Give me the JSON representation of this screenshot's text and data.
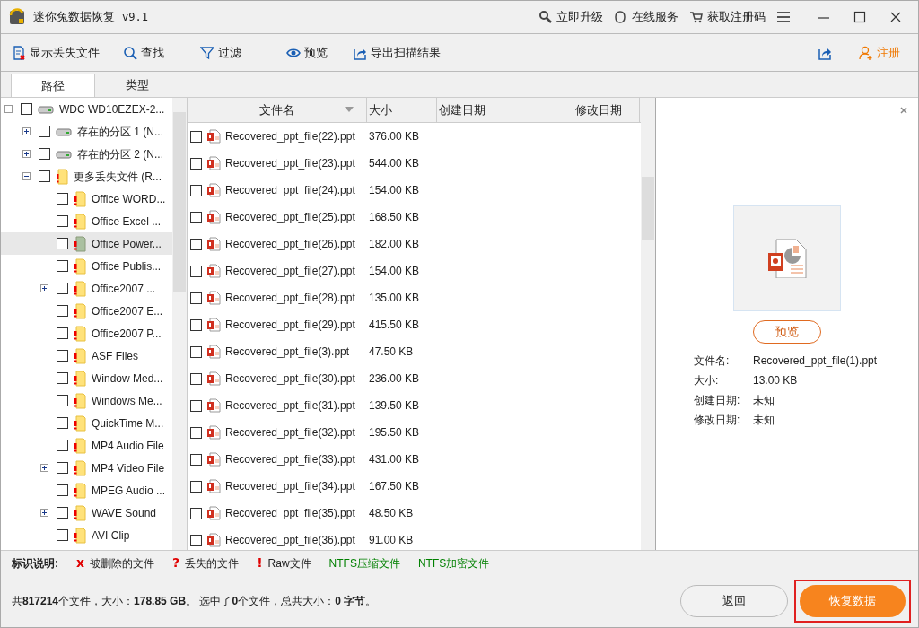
{
  "window": {
    "title": "迷你兔数据恢复",
    "version": "v9.1",
    "links": [
      {
        "kind": "key",
        "label": "立即升级"
      },
      {
        "kind": "chat",
        "label": "在线服务"
      },
      {
        "kind": "cart",
        "label": "获取注册码"
      }
    ]
  },
  "toolbar": [
    {
      "kind": "lost",
      "label": "显示丢失文件"
    },
    {
      "kind": "search",
      "label": "查找"
    },
    {
      "kind": "filter",
      "label": "过滤"
    },
    {
      "kind": "eye",
      "label": "预览"
    },
    {
      "kind": "export",
      "label": "导出扫描结果"
    }
  ],
  "register": "注册",
  "tabs": [
    {
      "label": "路径",
      "selected": true
    },
    {
      "label": "类型",
      "selected": false
    }
  ],
  "tree": [
    {
      "kind": "drive",
      "label": "WDC WD10EZEX-2...",
      "checked": false,
      "selected": false,
      "expanded": true,
      "children": [
        {
          "kind": "drive",
          "label": "存在的分区 1 (N...",
          "checked": false,
          "selected": false,
          "expanded": false
        },
        {
          "kind": "drive",
          "label": "存在的分区 2 (N...",
          "checked": false,
          "selected": false,
          "expanded": false
        },
        {
          "kind": "folder",
          "label": "更多丢失文件 (R...",
          "checked": false,
          "selected": false,
          "expanded": true,
          "children": [
            {
              "kind": "folder",
              "label": "Office WORD...",
              "checked": false,
              "selected": false
            },
            {
              "kind": "folder",
              "label": "Office Excel ...",
              "checked": false,
              "selected": false
            },
            {
              "kind": "folder",
              "label": "Office Power...",
              "checked": false,
              "selected": true
            },
            {
              "kind": "folder",
              "label": "Office Publis...",
              "checked": false,
              "selected": false
            },
            {
              "kind": "folder",
              "label": "Office2007 ...",
              "checked": false,
              "selected": false,
              "expanded": false
            },
            {
              "kind": "folder",
              "label": "Office2007 E...",
              "checked": false,
              "selected": false
            },
            {
              "kind": "folder",
              "label": "Office2007 P...",
              "checked": false,
              "selected": false
            },
            {
              "kind": "folder",
              "label": "ASF Files",
              "checked": false,
              "selected": false
            },
            {
              "kind": "folder",
              "label": "Window Med...",
              "checked": false,
              "selected": false
            },
            {
              "kind": "folder",
              "label": "Windows Me...",
              "checked": false,
              "selected": false
            },
            {
              "kind": "folder",
              "label": "QuickTime M...",
              "checked": false,
              "selected": false
            },
            {
              "kind": "folder",
              "label": "MP4 Audio File",
              "checked": false,
              "selected": false
            },
            {
              "kind": "folder",
              "label": "MP4 Video File",
              "checked": false,
              "selected": false,
              "expanded": false
            },
            {
              "kind": "folder",
              "label": "MPEG Audio ...",
              "checked": false,
              "selected": false
            },
            {
              "kind": "folder",
              "label": "WAVE Sound",
              "checked": false,
              "selected": false,
              "expanded": false
            },
            {
              "kind": "folder",
              "label": "AVI Clip",
              "checked": false,
              "selected": false
            }
          ]
        }
      ]
    }
  ],
  "table": {
    "columns": [
      "文件名",
      "大小",
      "创建日期",
      "修改日期"
    ],
    "rows": [
      {
        "name": "Recovered_ppt_file(22).ppt",
        "size": "376.00 KB",
        "checked": false
      },
      {
        "name": "Recovered_ppt_file(23).ppt",
        "size": "544.00 KB",
        "checked": false
      },
      {
        "name": "Recovered_ppt_file(24).ppt",
        "size": "154.00 KB",
        "checked": false
      },
      {
        "name": "Recovered_ppt_file(25).ppt",
        "size": "168.50 KB",
        "checked": false
      },
      {
        "name": "Recovered_ppt_file(26).ppt",
        "size": "182.00 KB",
        "checked": false
      },
      {
        "name": "Recovered_ppt_file(27).ppt",
        "size": "154.00 KB",
        "checked": false
      },
      {
        "name": "Recovered_ppt_file(28).ppt",
        "size": "135.00 KB",
        "checked": false
      },
      {
        "name": "Recovered_ppt_file(29).ppt",
        "size": "415.50 KB",
        "checked": false
      },
      {
        "name": "Recovered_ppt_file(3).ppt",
        "size": "47.50 KB",
        "checked": false
      },
      {
        "name": "Recovered_ppt_file(30).ppt",
        "size": "236.00 KB",
        "checked": false
      },
      {
        "name": "Recovered_ppt_file(31).ppt",
        "size": "139.50 KB",
        "checked": false
      },
      {
        "name": "Recovered_ppt_file(32).ppt",
        "size": "195.50 KB",
        "checked": false
      },
      {
        "name": "Recovered_ppt_file(33).ppt",
        "size": "431.00 KB",
        "checked": false
      },
      {
        "name": "Recovered_ppt_file(34).ppt",
        "size": "167.50 KB",
        "checked": false
      },
      {
        "name": "Recovered_ppt_file(35).ppt",
        "size": "48.50 KB",
        "checked": false
      },
      {
        "name": "Recovered_ppt_file(36).ppt",
        "size": "91.00 KB",
        "checked": false
      }
    ]
  },
  "preview": {
    "button": "预览",
    "fields": [
      {
        "label": "文件名:",
        "value": "Recovered_ppt_file(1).ppt"
      },
      {
        "label": "大小:",
        "value": "13.00 KB"
      },
      {
        "label": "创建日期:",
        "value": "未知"
      },
      {
        "label": "修改日期:",
        "value": "未知"
      }
    ]
  },
  "legend": {
    "title": "标识说明:",
    "items": [
      {
        "mark": "x",
        "label": "被删除的文件",
        "color": "#e00000"
      },
      {
        "mark": "?",
        "label": "丢失的文件",
        "color": "#e00000"
      },
      {
        "mark": "!",
        "label": "Raw文件",
        "color": "#e00000"
      },
      {
        "label": "NTFS压缩文件",
        "color": "#008000"
      },
      {
        "label": "NTFS加密文件",
        "color": "#008000"
      }
    ]
  },
  "status": "共**817214**个文件，大小：**178.85 GB**。 选中了**0**个文件，总共大小：**0 字节**。",
  "buttons": {
    "back": "返回",
    "recover": "恢复数据",
    "recover_highlighted": true
  }
}
